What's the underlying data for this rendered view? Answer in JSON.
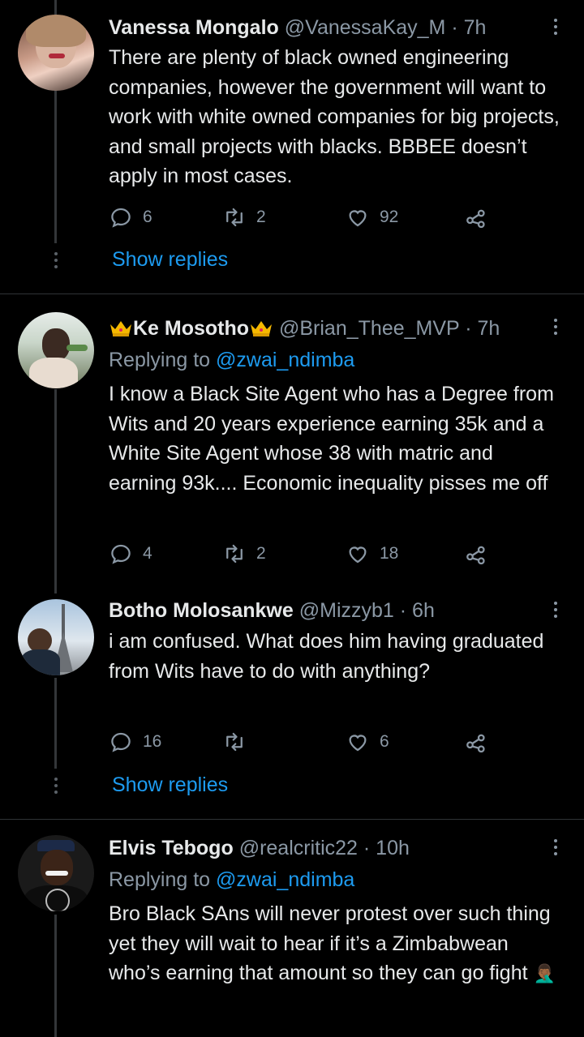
{
  "tweets": [
    {
      "name": "Vanessa Mongalo",
      "handle": "@VanessaKay_M",
      "time": "· 7h",
      "text": "There are plenty of black owned engineering companies, however the government will want to work with white owned companies for big projects, and small projects with blacks. BBBEE doesn’t apply in most cases.",
      "replies": "6",
      "retweets": "2",
      "likes": "92",
      "show_replies": "Show replies"
    },
    {
      "name": "Ke Mosotho",
      "handle": "@Brian_Thee_MVP",
      "time": "· 7h",
      "replying_label": "Replying to",
      "replying_to": "@zwai_ndimba",
      "text": "I know a Black Site Agent who has a Degree from Wits and 20 years experience earning 35k and a White Site Agent whose 38 with matric and earning 93k.... Economic inequality pisses me off",
      "replies": "4",
      "retweets": "2",
      "likes": "18"
    },
    {
      "name": "Botho Molosankwe",
      "handle": "@Mizzyb1",
      "time": "· 6h",
      "text": "i am confused. What does him having graduated from Wits have to do with anything?",
      "replies": "16",
      "retweets": "",
      "likes": "6",
      "show_replies": "Show replies"
    },
    {
      "name": "Elvis Tebogo",
      "handle": "@realcritic22",
      "time": "· 10h",
      "replying_label": "Replying to",
      "replying_to": "@zwai_ndimba",
      "text": "Bro Black SAns will never protest over such thing yet they will wait to hear if it’s a Zimbabwean who’s earning that amount so they can go fight",
      "emoji": "🤦🏾‍♂️"
    }
  ],
  "colors": {
    "background": "#000000",
    "text": "#e7e9ea",
    "secondary": "#8b98a5",
    "accent": "#1d9bf0",
    "divider": "#2f3336"
  }
}
